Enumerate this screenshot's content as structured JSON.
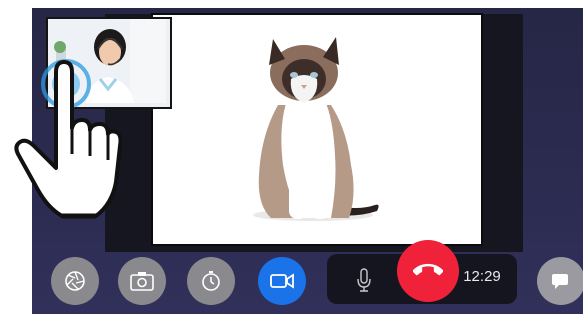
{
  "call": {
    "timer": "12:29"
  },
  "controls": {
    "items": [
      {
        "name": "shutter-icon"
      },
      {
        "name": "camera-icon"
      },
      {
        "name": "timer-icon"
      },
      {
        "name": "video-camera-icon"
      },
      {
        "name": "microphone-icon"
      },
      {
        "name": "phone-icon"
      },
      {
        "name": "chat-icon"
      }
    ]
  },
  "colors": {
    "accent": "#1a73e8",
    "end_call": "#f0223a",
    "control_grey": "#8a8a8e",
    "background": "#2a2a4a"
  },
  "overlay": {
    "pointer": "hand-pointer-icon"
  }
}
